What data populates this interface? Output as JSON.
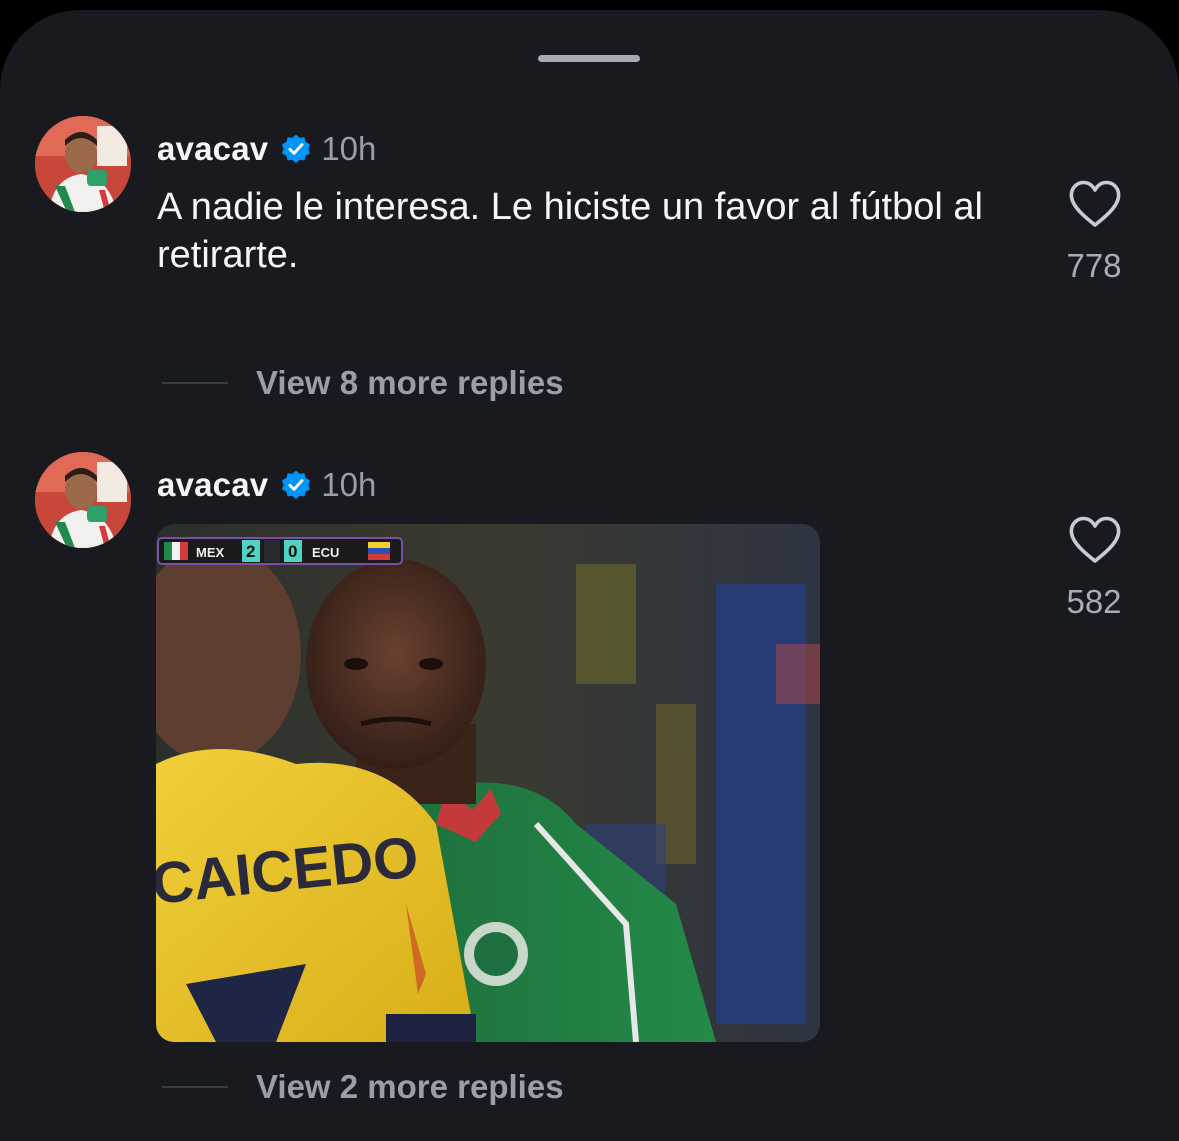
{
  "sheet": {
    "handle": "drag-handle"
  },
  "comments": [
    {
      "username": "avacav",
      "timestamp": "10h",
      "text": "A nadie le interesa. Le hiciste un favor al fútbol al retirarte.",
      "likes": "778",
      "replies": "View 8 more replies"
    },
    {
      "username": "avacav",
      "timestamp": "10h",
      "media": {
        "scoreboard": {
          "home": "MEX",
          "home_score": "2",
          "away_score": "0",
          "away": "ECU"
        },
        "jersey_name": "CAICEDO"
      },
      "likes": "582",
      "replies": "View 2 more replies"
    }
  ],
  "icons": {
    "verified": "verified-badge-icon",
    "like": "heart-icon"
  },
  "colors": {
    "background": "#181a1f",
    "verified": "#0095f6",
    "text_primary": "#f3f5f7",
    "text_secondary": "#9a9ea6"
  }
}
